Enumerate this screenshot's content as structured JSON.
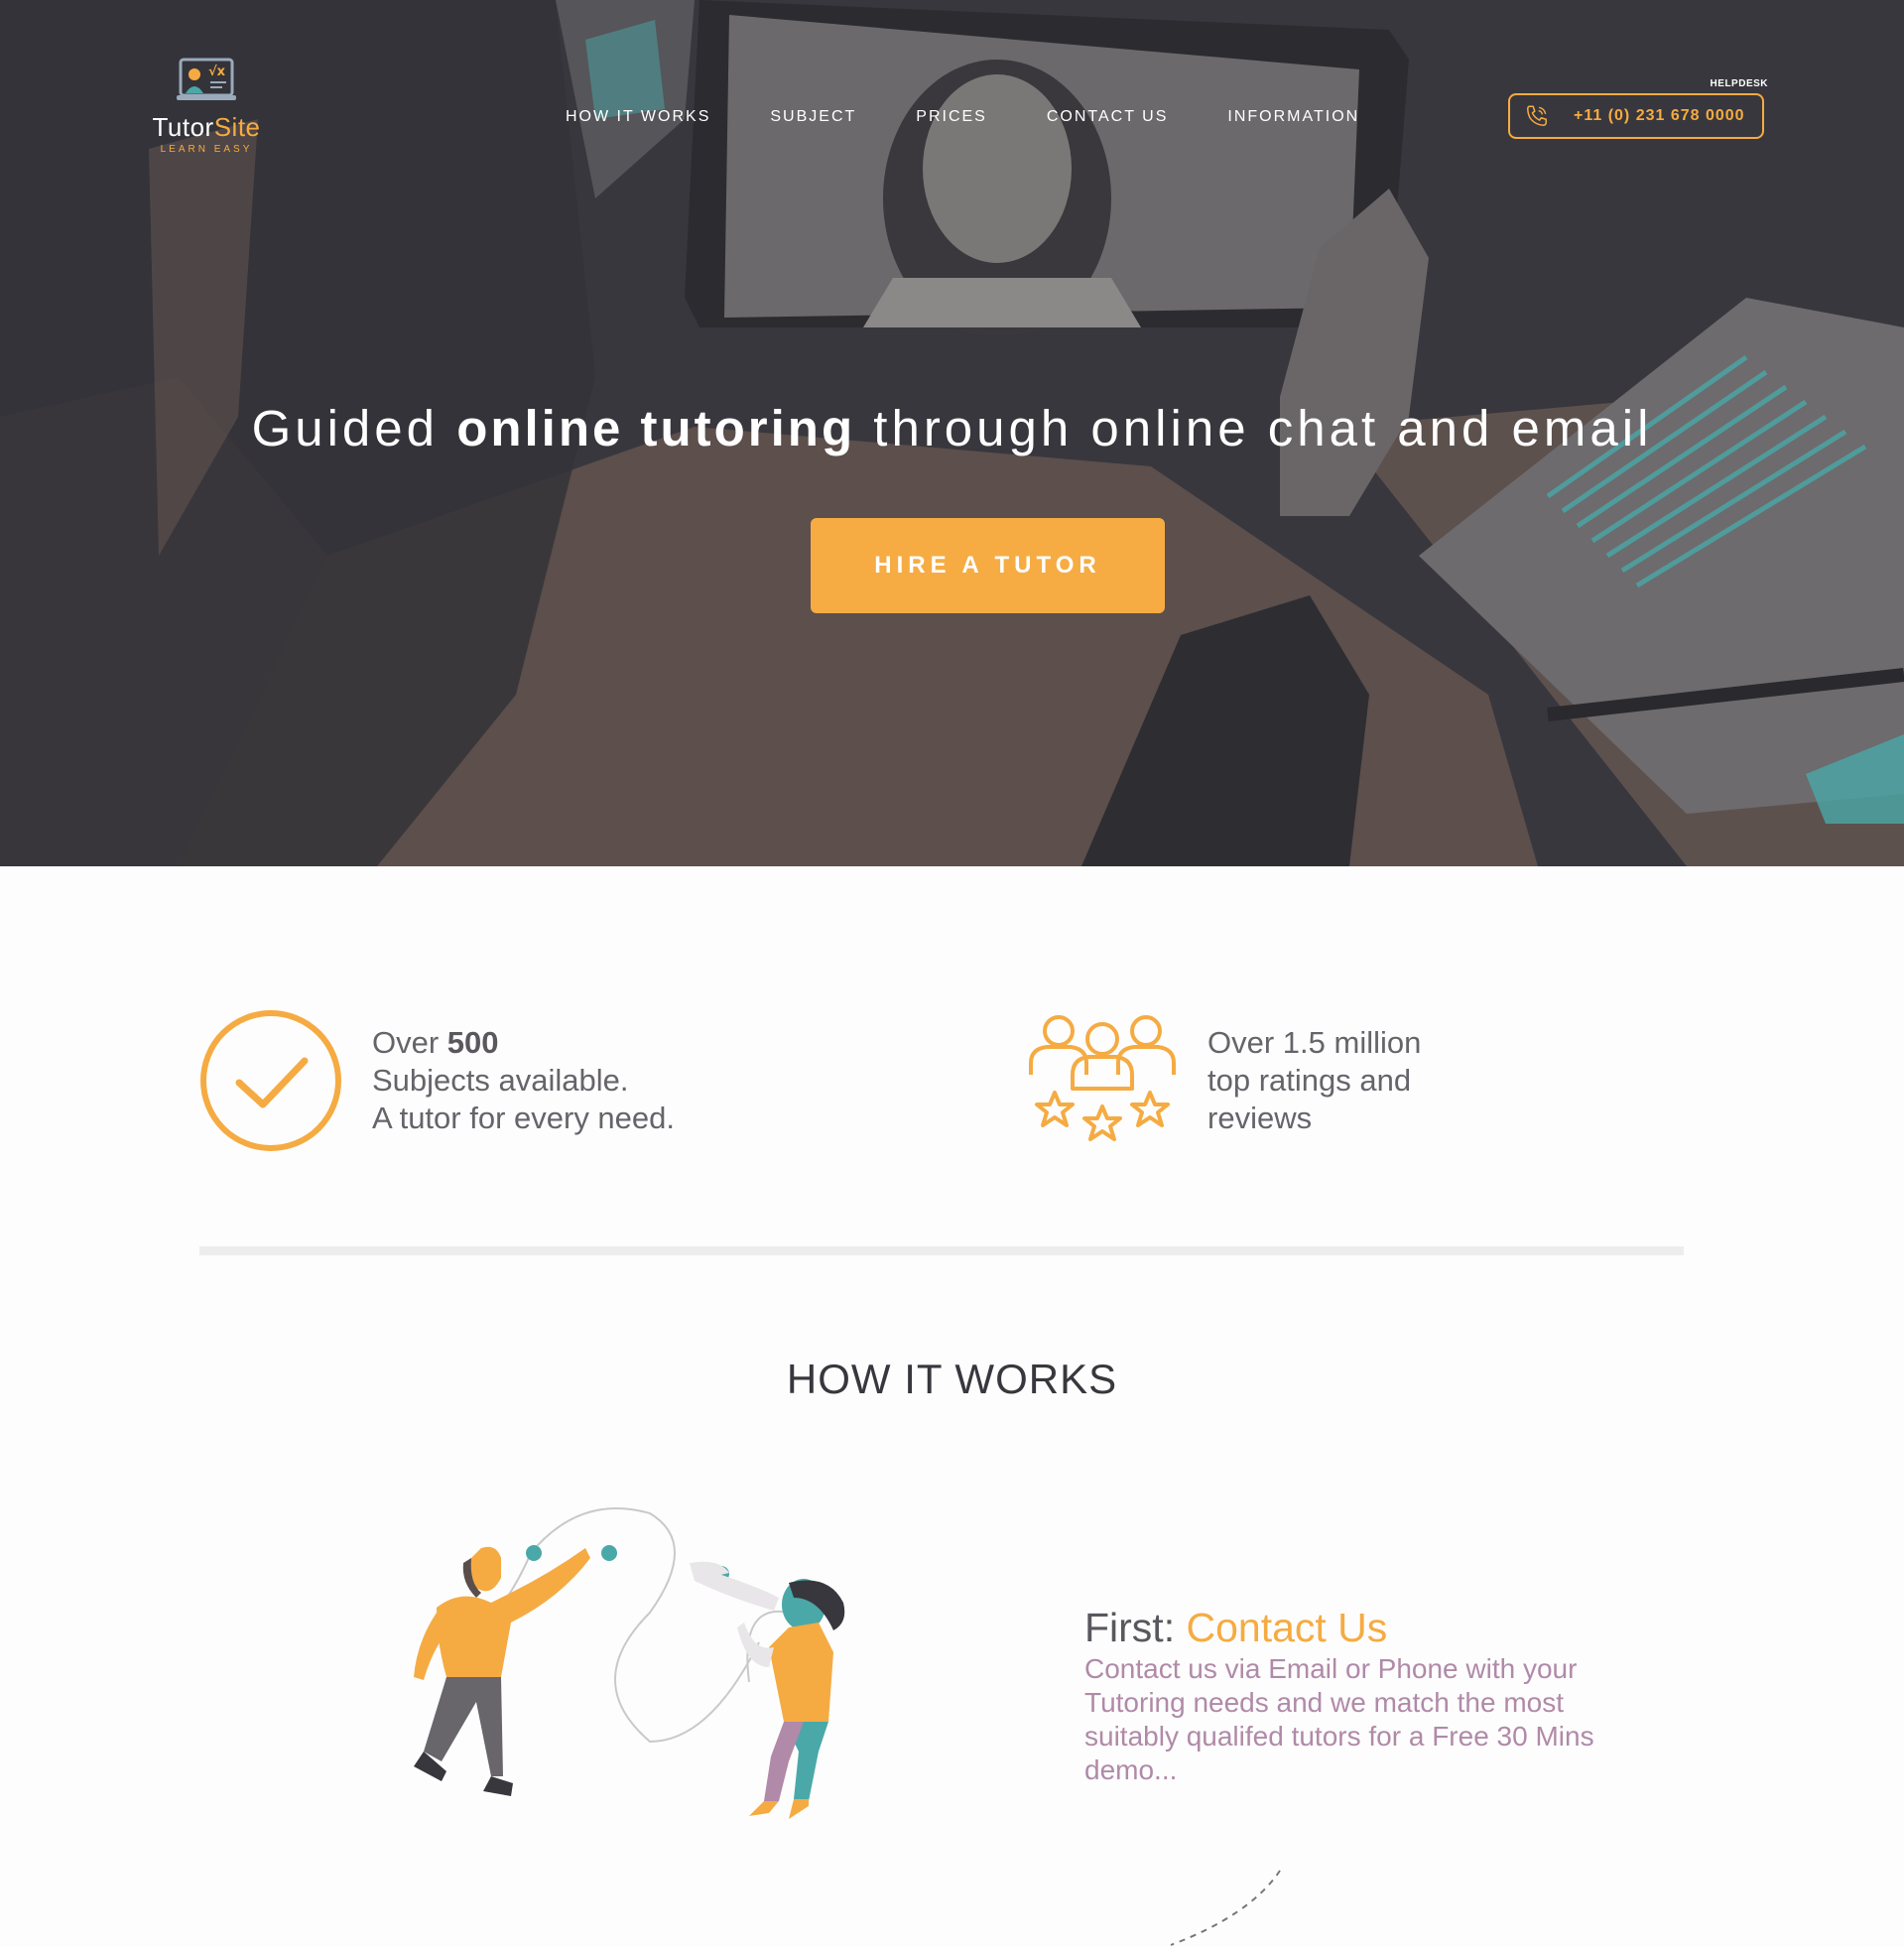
{
  "header": {
    "logo": {
      "brand_part1": "Tutor",
      "brand_part2": "Site",
      "tagline": "LEARN EASY"
    },
    "nav": [
      {
        "label": "HOW IT WORKS"
      },
      {
        "label": "SUBJECT"
      },
      {
        "label": "PRICES"
      },
      {
        "label": "CONTACT US"
      },
      {
        "label": "INFORMATION"
      }
    ],
    "helpdesk_label": "HELPDESK",
    "phone": "+11 (0) 231 678 0000",
    "phone_icon": "phone-icon"
  },
  "hero": {
    "headline_part1": "Guided ",
    "headline_bold": "online tutoring",
    "headline_part2": " through online chat and email",
    "cta_label": "HIRE A TUTOR"
  },
  "stats": [
    {
      "icon": "checkmark-circle-icon",
      "line1_prefix": "Over ",
      "line1_bold": "500",
      "line2": "Subjects available.",
      "line3": "A tutor for every need."
    },
    {
      "icon": "people-stars-icon",
      "line1": "Over 1.5 million",
      "line2": "top ratings and",
      "line3": "reviews"
    }
  ],
  "how_it_works": {
    "title": "HOW IT WORKS",
    "step": {
      "prefix": "First: ",
      "title": "Contact Us",
      "description": "Contact us via Email or Phone with your Tutoring needs and we match the most suitably qualifed tutors for a Free 30 Mins demo..."
    }
  },
  "colors": {
    "accent": "#f5ab42",
    "hero_dark": "#38373d",
    "hero_brown": "#5a4e4b",
    "teal": "#4aa8a8",
    "desc_mauve": "#b08aa8"
  }
}
